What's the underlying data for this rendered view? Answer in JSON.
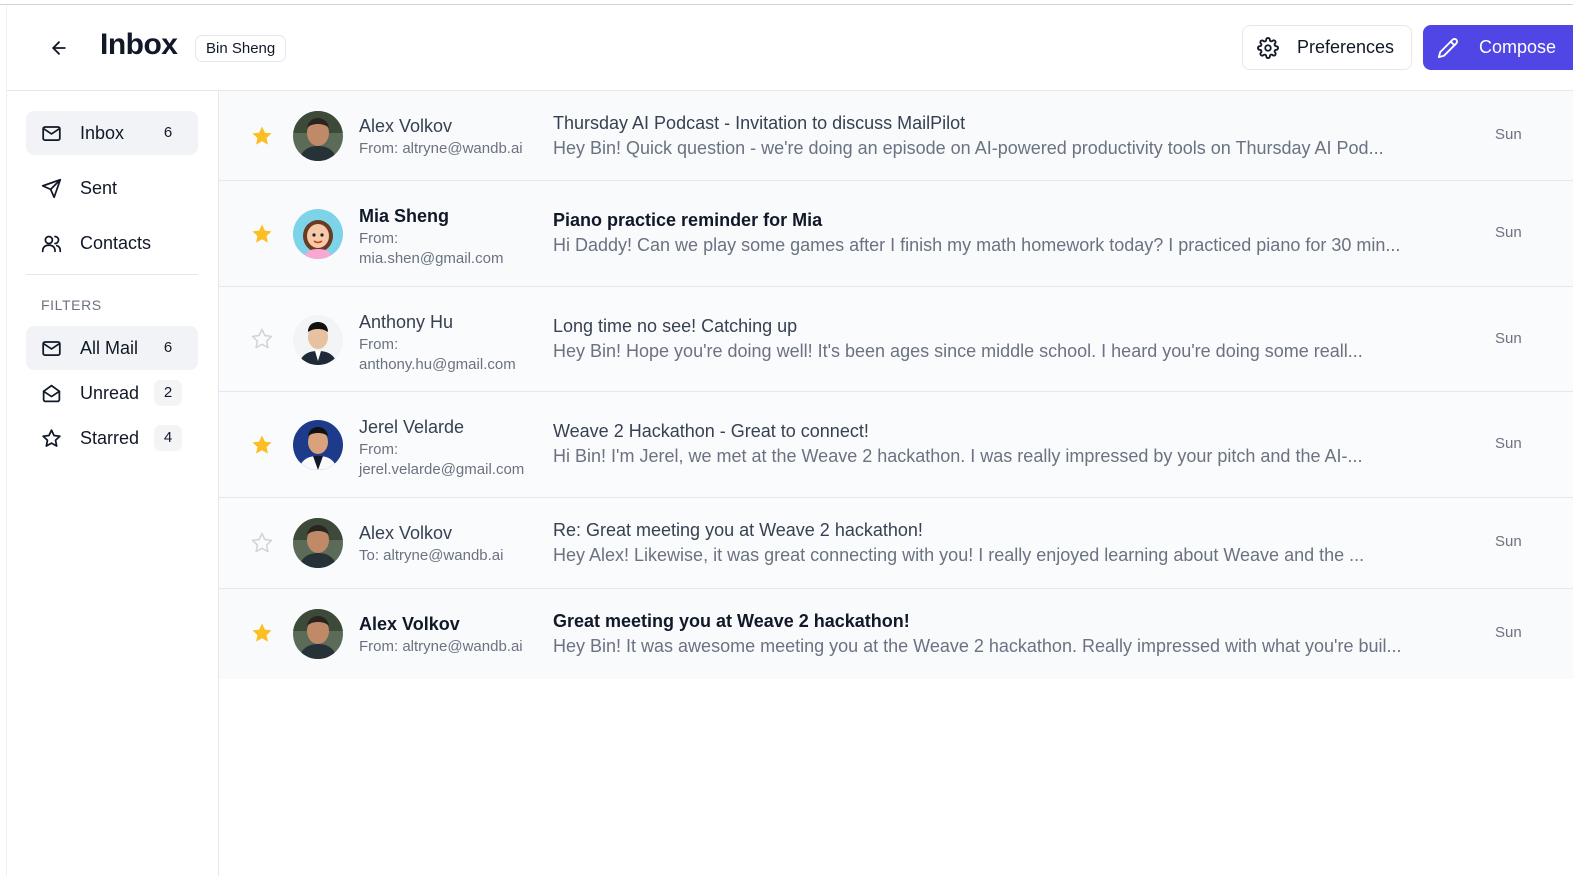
{
  "header": {
    "title": "Inbox",
    "user_badge": "Bin Sheng",
    "preferences_label": "Preferences",
    "compose_label": "Compose"
  },
  "colors": {
    "accent": "#4f46e5",
    "star_active": "#fbbf24",
    "star_inactive": "#d1d5db"
  },
  "sidebar": {
    "nav": [
      {
        "label": "Inbox",
        "icon": "mail-icon",
        "count": "6",
        "active": true
      },
      {
        "label": "Sent",
        "icon": "send-icon",
        "count": "",
        "active": false
      },
      {
        "label": "Contacts",
        "icon": "users-icon",
        "count": "",
        "active": false
      }
    ],
    "filters_label": "FILTERS",
    "filters": [
      {
        "label": "All Mail",
        "icon": "mail-icon",
        "count": "6",
        "active": true
      },
      {
        "label": "Unread",
        "icon": "mail-open-icon",
        "count": "2",
        "active": false
      },
      {
        "label": "Starred",
        "icon": "star-icon",
        "count": "4",
        "active": false
      }
    ]
  },
  "emails": [
    {
      "sender": "Alex Volkov",
      "address_line1": "From: altryne@wandb.ai",
      "address_line2": "",
      "subject": "Thursday AI Podcast - Invitation to discuss MailPilot",
      "preview": "Hey Bin! Quick question - we're doing an episode on AI-powered productivity tools on Thursday AI Pod...",
      "date": "Sun",
      "starred": true,
      "unread": false
    },
    {
      "sender": "Mia Sheng",
      "address_line1": "From:",
      "address_line2": "mia.shen@gmail.com",
      "subject": "Piano practice reminder for Mia",
      "preview": "Hi Daddy! Can we play some games after I finish my math homework today? I practiced piano for 30 min...",
      "date": "Sun",
      "starred": true,
      "unread": true
    },
    {
      "sender": "Anthony Hu",
      "address_line1": "From:",
      "address_line2": "anthony.hu@gmail.com",
      "subject": "Long time no see! Catching up",
      "preview": "Hey Bin! Hope you're doing well! It's been ages since middle school. I heard you're doing some reall...",
      "date": "Sun",
      "starred": false,
      "unread": false
    },
    {
      "sender": "Jerel Velarde",
      "address_line1": "From:",
      "address_line2": "jerel.velarde@gmail.com",
      "subject": "Weave 2 Hackathon - Great to connect!",
      "preview": "Hi Bin! I'm Jerel, we met at the Weave 2 hackathon. I was really impressed by your pitch and the AI-...",
      "date": "Sun",
      "starred": true,
      "unread": false
    },
    {
      "sender": "Alex Volkov",
      "address_line1": "To: altryne@wandb.ai",
      "address_line2": "",
      "subject": "Re: Great meeting you at Weave 2 hackathon!",
      "preview": "Hey Alex! Likewise, it was great connecting with you! I really enjoyed learning about Weave and the ...",
      "date": "Sun",
      "starred": false,
      "unread": false
    },
    {
      "sender": "Alex Volkov",
      "address_line1": "From: altryne@wandb.ai",
      "address_line2": "",
      "subject": "Great meeting you at Weave 2 hackathon!",
      "preview": "Hey Bin! It was awesome meeting you at the Weave 2 hackathon. Really impressed with what you're buil...",
      "date": "Sun",
      "starred": true,
      "unread": true
    }
  ]
}
